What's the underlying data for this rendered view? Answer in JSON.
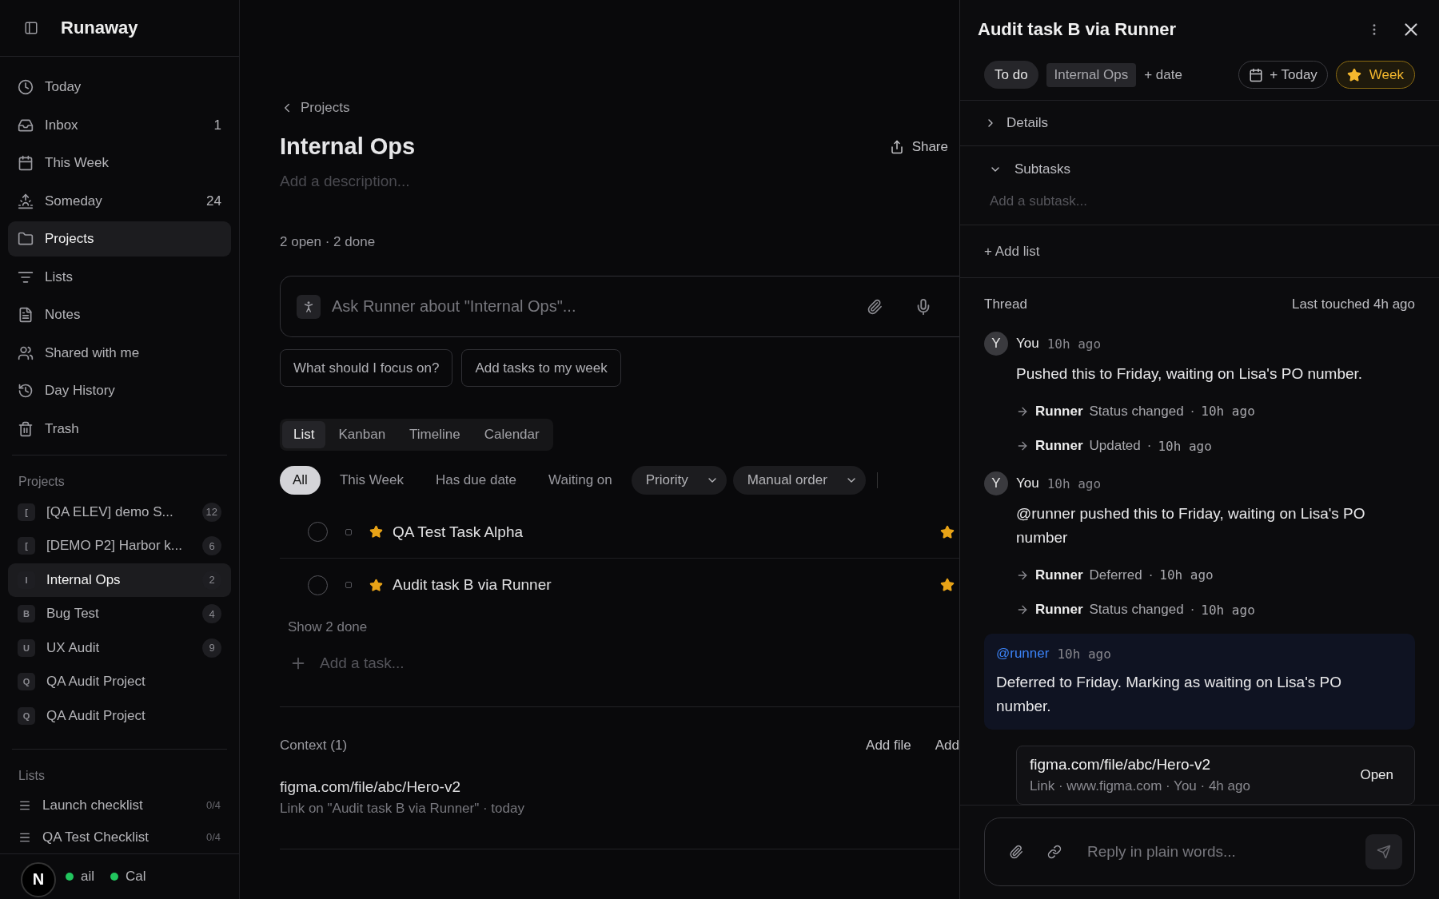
{
  "app": {
    "name": "Runaway"
  },
  "sidebar": {
    "nav": [
      {
        "label": "Today",
        "selected": false
      },
      {
        "label": "Inbox",
        "count": "1",
        "selected": false
      },
      {
        "label": "This Week",
        "selected": false
      },
      {
        "label": "Someday",
        "count": "24",
        "selected": false
      },
      {
        "label": "Projects",
        "selected": true
      },
      {
        "label": "Lists",
        "selected": false
      },
      {
        "label": "Notes",
        "selected": false
      },
      {
        "label": "Shared with me",
        "selected": false
      },
      {
        "label": "Day History",
        "selected": false
      },
      {
        "label": "Trash",
        "selected": false
      }
    ],
    "projects_heading": "Projects",
    "projects": [
      {
        "initial": "[",
        "name": "[QA ELEV] demo S...",
        "count": "12",
        "selected": false
      },
      {
        "initial": "[",
        "name": "[DEMO P2] Harbor k...",
        "count": "6",
        "selected": false
      },
      {
        "initial": "I",
        "name": "Internal Ops",
        "count": "2",
        "selected": true
      },
      {
        "initial": "B",
        "name": "Bug Test",
        "count": "4",
        "selected": false
      },
      {
        "initial": "U",
        "name": "UX Audit",
        "count": "9",
        "selected": false
      },
      {
        "initial": "Q",
        "name": "QA Audit Project",
        "selected": false
      },
      {
        "initial": "Q",
        "name": "QA Audit Project",
        "selected": false
      }
    ],
    "lists_heading": "Lists",
    "lists": [
      {
        "name": "Launch checklist",
        "progress": "0/4"
      },
      {
        "name": "QA Test Checklist",
        "progress": "0/4"
      }
    ],
    "integrations": [
      {
        "label": "ail",
        "color": "#22c55e"
      },
      {
        "label": "Cal",
        "color": "#22c55e"
      }
    ],
    "badge": "N"
  },
  "main": {
    "breadcrumb": "Projects",
    "title": "Internal Ops",
    "share": "Share",
    "description_placeholder": "Add a description...",
    "stats": "2 open · 2 done",
    "ask": {
      "placeholder": "Ask Runner about \"Internal Ops\"..."
    },
    "suggestions": [
      "What should I focus on?",
      "Add tasks to my week"
    ],
    "views": [
      {
        "label": "List",
        "selected": true
      },
      {
        "label": "Kanban",
        "selected": false
      },
      {
        "label": "Timeline",
        "selected": false
      },
      {
        "label": "Calendar",
        "selected": false
      }
    ],
    "filters": [
      {
        "label": "All",
        "selected": true
      },
      {
        "label": "This Week",
        "selected": false
      },
      {
        "label": "Has due date",
        "selected": false
      },
      {
        "label": "Waiting on",
        "selected": false
      }
    ],
    "selects": [
      {
        "label": "Priority"
      },
      {
        "label": "Manual order"
      }
    ],
    "tasks": [
      {
        "title": "QA Test Task Alpha",
        "done": false,
        "starred": true,
        "in_week": true
      },
      {
        "title": "Audit task B via Runner",
        "done": false,
        "starred": true,
        "in_week": true
      }
    ],
    "show_done": "Show 2 done",
    "add_task_placeholder": "Add a task...",
    "context": {
      "heading": "Context (1)",
      "actions": [
        "Add file",
        "Add"
      ],
      "items": [
        {
          "title": "figma.com/file/abc/Hero-v2",
          "meta": "Link on \"Audit task B via Runner\" · today"
        }
      ]
    }
  },
  "panel": {
    "title": "Audit task B via Runner",
    "status": "To do",
    "project": "Internal Ops",
    "add_date": "+ date",
    "today": "+ Today",
    "week": {
      "label": "Week",
      "on": true
    },
    "details": {
      "label": "Details",
      "expanded": false
    },
    "subtasks": {
      "label": "Subtasks",
      "expanded": true,
      "placeholder": "Add a subtask..."
    },
    "add_list": "+ Add list",
    "thread": {
      "heading": "Thread",
      "last_touched": "Last touched 4h ago",
      "entries": [
        {
          "kind": "message",
          "avatar": "Y",
          "author": "You",
          "time": "10h ago",
          "text": "Pushed this to Friday, waiting on Lisa's PO number."
        },
        {
          "kind": "event",
          "actor": "Runner",
          "action": "Status changed",
          "sep": "·",
          "time": "10h ago"
        },
        {
          "kind": "event",
          "actor": "Runner",
          "action": "Updated",
          "sep": "·",
          "time": "10h ago"
        },
        {
          "kind": "message",
          "avatar": "Y",
          "author": "You",
          "time": "10h ago",
          "text": "@runner pushed this to Friday, waiting on Lisa's PO number"
        },
        {
          "kind": "event",
          "actor": "Runner",
          "action": "Deferred",
          "sep": "·",
          "time": "10h ago"
        },
        {
          "kind": "event",
          "actor": "Runner",
          "action": "Status changed",
          "sep": "·",
          "time": "10h ago"
        },
        {
          "kind": "reply",
          "author": "@runner",
          "time": "10h ago",
          "text": "Deferred to Friday. Marking as waiting on Lisa's PO number."
        },
        {
          "kind": "attachment",
          "title": "figma.com/file/abc/Hero-v2",
          "meta": "Link · www.figma.com · You · 4h ago",
          "action": "Open"
        }
      ]
    },
    "composer": {
      "placeholder": "Reply in plain words..."
    }
  }
}
